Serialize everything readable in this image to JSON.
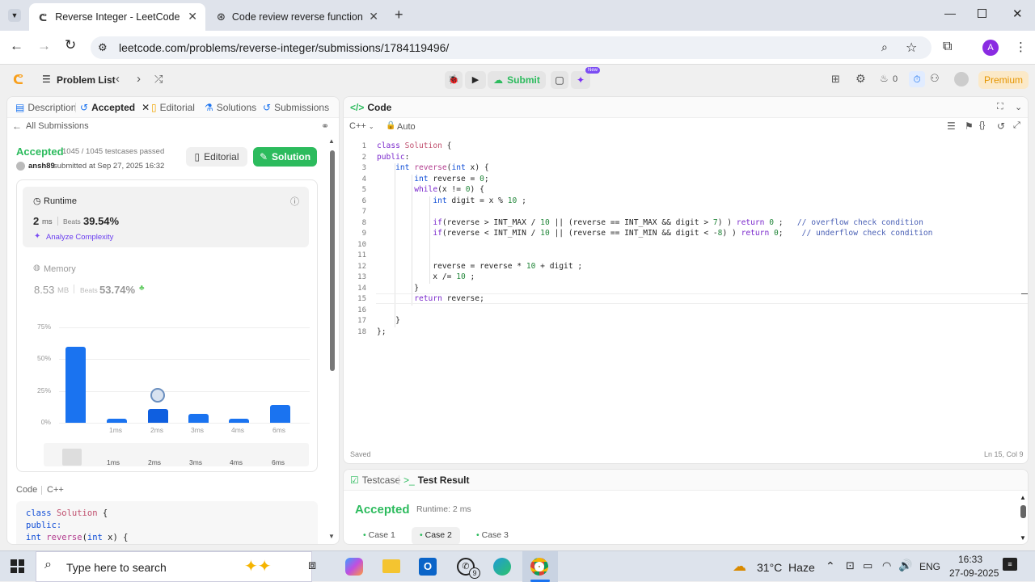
{
  "browser": {
    "tabs": [
      {
        "title": "Reverse Integer - LeetCode",
        "active": true
      },
      {
        "title": "Code review reverse function",
        "active": false
      }
    ],
    "url": "leetcode.com/problems/reverse-integer/submissions/1784119496/",
    "profile_initial": "A"
  },
  "lc_header": {
    "problem_list": "Problem List",
    "submit": "Submit",
    "new_badge": "New",
    "streak": "0",
    "premium": "Premium"
  },
  "left_tabs": {
    "description": "Description",
    "accepted": "Accepted",
    "editorial": "Editorial",
    "solutions": "Solutions",
    "submissions": "Submissions"
  },
  "submission": {
    "back": "All Submissions",
    "status": "Accepted",
    "testcases": "1045 / 1045 testcases passed",
    "user": "ansh89",
    "submitted": "submitted at Sep 27, 2025 16:32",
    "editorial_btn": "Editorial",
    "solution_btn": "Solution",
    "runtime_label": "Runtime",
    "runtime_value": "2",
    "runtime_unit": "ms",
    "beats_label": "Beats",
    "runtime_beats": "39.54%",
    "analyze": "Analyze Complexity",
    "memory_label": "Memory",
    "memory_value": "8.53",
    "memory_unit": "MB",
    "memory_beats": "53.74%",
    "code_label": "Code",
    "code_lang": "C++",
    "code_preview": [
      "class Solution {",
      "public:",
      "    int reverse(int x) {"
    ]
  },
  "chart_data": {
    "type": "bar",
    "categories": [
      "",
      "1ms",
      "2ms",
      "3ms",
      "4ms",
      "6ms"
    ],
    "values": [
      60,
      3,
      11,
      7,
      3,
      14
    ],
    "ylim": [
      0,
      75
    ],
    "yticks": [
      "75%",
      "50%",
      "25%",
      "0%"
    ],
    "highlight": "2ms",
    "mini_labels": [
      "1ms",
      "2ms",
      "3ms",
      "4ms",
      "6ms"
    ]
  },
  "editor": {
    "title": "Code",
    "lang": "C++",
    "mode": "Auto",
    "saved": "Saved",
    "cursor": "Ln 15, Col 9",
    "lines": [
      "class Solution {",
      "public:",
      "    int reverse(int x) {",
      "        int reverse = 0;",
      "        while(x != 0) {",
      "            int digit = x % 10 ;",
      "",
      "            if(reverse > INT_MAX / 10 || (reverse == INT_MAX && digit > 7) ) return 0 ;   // overflow check condition",
      "            if(reverse < INT_MIN / 10 || (reverse == INT_MIN && digit < -8) ) return 0;    // underflow check condition",
      "",
      "",
      "            reverse = reverse * 10 + digit ;",
      "            x /= 10 ;",
      "        }",
      "        return reverse;",
      "",
      "    }",
      "};"
    ]
  },
  "result": {
    "testcase_tab": "Testcase",
    "result_tab": "Test Result",
    "status": "Accepted",
    "runtime": "Runtime: 2 ms",
    "cases": [
      "Case 1",
      "Case 2",
      "Case 3"
    ]
  },
  "taskbar": {
    "search_placeholder": "Type here to search",
    "weather": "31°C  Haze",
    "lang": "ENG",
    "time": "16:33",
    "date": "27-09-2025",
    "whatsapp_badge": "9"
  }
}
